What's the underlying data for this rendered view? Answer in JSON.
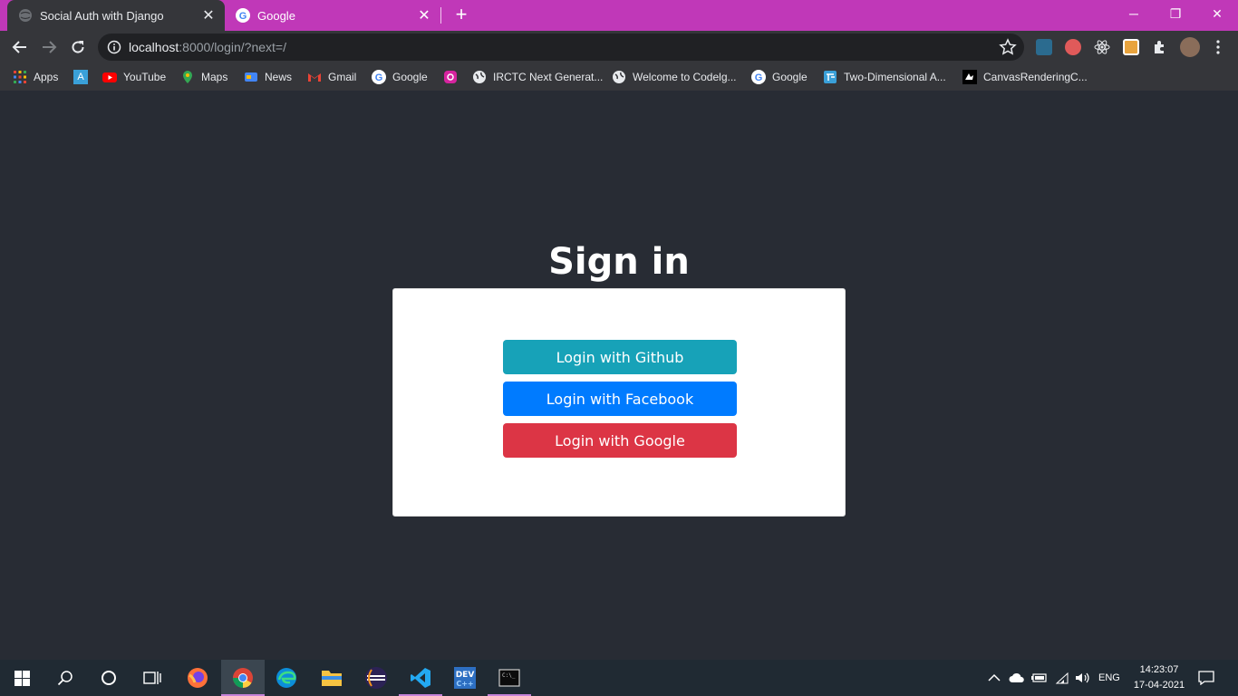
{
  "browser": {
    "tabs": [
      {
        "title": "Social Auth with Django",
        "active": true,
        "icon": "globe-icon"
      },
      {
        "title": "Google",
        "active": false,
        "icon": "google-icon"
      }
    ],
    "address": {
      "host": "localhost",
      "rest": ":8000/login/?next=/"
    },
    "accent_color": "#c038b8"
  },
  "bookmarks": [
    {
      "label": "Apps",
      "icon": "apps-grid-icon"
    },
    {
      "label": "",
      "icon": "a-square-icon"
    },
    {
      "label": "YouTube",
      "icon": "youtube-icon"
    },
    {
      "label": "Maps",
      "icon": "maps-pin-icon"
    },
    {
      "label": "News",
      "icon": "news-icon"
    },
    {
      "label": "Gmail",
      "icon": "gmail-icon"
    },
    {
      "label": "Google",
      "icon": "google-icon"
    },
    {
      "label": "",
      "icon": "instagram-icon"
    },
    {
      "label": "IRCTC Next Generat...",
      "icon": "globe-icon"
    },
    {
      "label": "Welcome to Codelg...",
      "icon": "globe-icon"
    },
    {
      "label": "Google",
      "icon": "google-icon"
    },
    {
      "label": "Two-Dimensional A...",
      "icon": "blue-doc-icon"
    },
    {
      "label": "CanvasRenderingC...",
      "icon": "mdn-icon"
    }
  ],
  "page": {
    "heading": "Sign in",
    "buttons": [
      {
        "label": "Login with Github",
        "color": "#17a2b8"
      },
      {
        "label": "Login with Facebook",
        "color": "#007bff"
      },
      {
        "label": "Login with Google",
        "color": "#dc3545"
      }
    ],
    "background": "#282c34"
  },
  "taskbar": {
    "apps": [
      "windows-start-icon",
      "search-icon",
      "cortana-icon",
      "task-view-icon",
      "firefox-icon",
      "chrome-icon",
      "edge-icon",
      "file-explorer-icon",
      "eclipse-icon",
      "vscode-icon",
      "devcpp-icon",
      "terminal-icon"
    ],
    "language": "ENG",
    "time": "14:23:07",
    "date": "17-04-2021"
  }
}
